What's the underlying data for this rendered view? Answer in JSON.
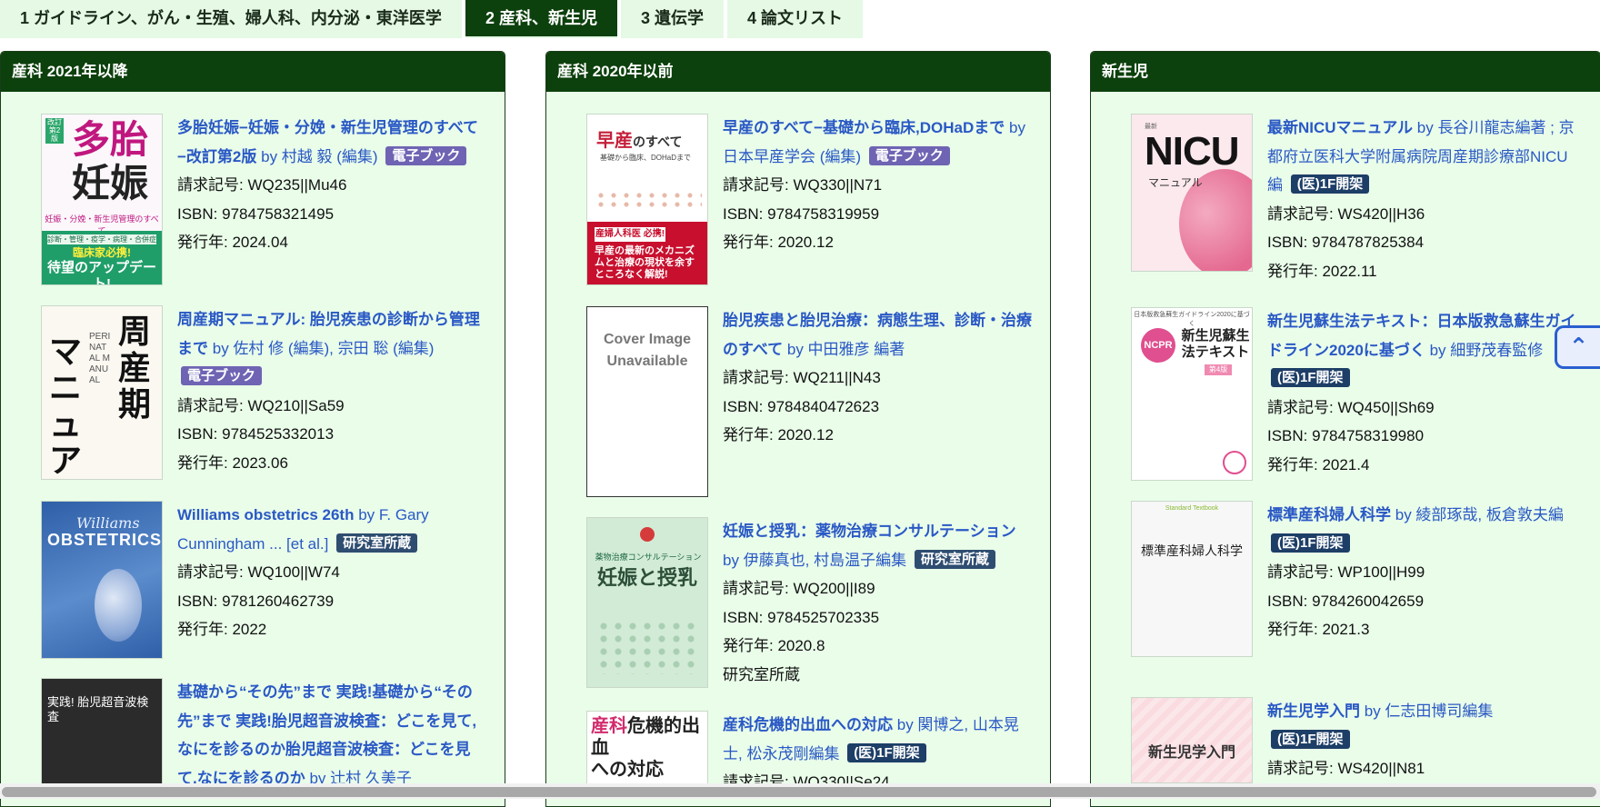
{
  "tabs": [
    {
      "label": "1 ガイドライン、がん・生殖、婦人科、内分泌・東洋医学",
      "active": false
    },
    {
      "label": "2 産科、新生児",
      "active": true
    },
    {
      "label": "3 遺伝学",
      "active": false
    },
    {
      "label": "4 論文リスト",
      "active": false
    }
  ],
  "columns": [
    {
      "heading": "産科 2021年以降",
      "books": [
        {
          "title": "多胎妊娠−妊娠・分娩・新生児管理のすべて−改訂第2版",
          "authors": "by 村越 毅 (編集)",
          "badge": "電子ブック",
          "call": "請求記号: WQ235||Mu46",
          "isbn": "ISBN: 9784758321495",
          "year": "発行年: 2024.04",
          "cover": {
            "tag": "改訂第2版",
            "line1": "多胎",
            "line2": "妊娠",
            "sub": "妊娠・分娩・新生児管理のすべて",
            "b1": "診断・管理・疫学・病理・合併症",
            "b2": "臨床家必携!",
            "b3": "待望のアップデート!"
          }
        },
        {
          "title": "周産期マニュアル: 胎児疾患の診断から管理まで",
          "authors": "by 佐村 修 (編集), 宗田 聡 (編集)",
          "badge": "電子ブック",
          "call": "請求記号: WQ210||Sa59",
          "isbn": "ISBN: 9784525332013",
          "year": "発行年: 2023.06",
          "cover": {
            "v1": "周産期",
            "v2": "マニュアル",
            "en": "PERINATAL MANUAL"
          }
        },
        {
          "title": "Williams obstetrics 26th",
          "authors": "by F. Gary Cunningham ... [et al.]",
          "badge": "研究室所蔵",
          "call": "請求記号: WQ100||W74",
          "isbn": "ISBN: 9781260462739",
          "year": "発行年: 2022",
          "cover": {
            "w": "Williams",
            "o": "OBSTETRICS"
          }
        },
        {
          "title": "基礎から“その先”まで 実践!基礎から“その先”まで 実践!胎児超音波検査：どこを見て,なにを診るのか胎児超音波検査：どこを見て,なにを診るのか",
          "authors": "by 辻村 久美子",
          "badge": "",
          "call": "",
          "isbn": "",
          "year": "",
          "cover": {
            "t": "実践! 胎児超音波検査"
          }
        }
      ]
    },
    {
      "heading": "産科 2020年以前",
      "books": [
        {
          "title": "早産のすべて−基礎から臨床,DOHaDまで",
          "authors": "by 日本早産学会 (編集)",
          "badge": "電子ブック",
          "call": "請求記号: WQ330||N71",
          "isbn": "ISBN: 9784758319959",
          "year": "発行年: 2020.12",
          "cover": {
            "t": "早産",
            "t2": "のすべて",
            "s": "基礎から臨床、DOHaDまで",
            "p": "産婦人科医 必携!",
            "q": "早産の最新のメカニズムと治療の現状を余すところなく解説!"
          }
        },
        {
          "title": "胎児疾患と胎児治療：病態生理、診断・治療のすべて",
          "authors": "by 中田雅彦 編著",
          "badge": "",
          "call": "請求記号: WQ211||N43",
          "isbn": "ISBN: 9784840472623",
          "year": "発行年: 2020.12",
          "cover": {
            "u1": "Cover Image",
            "u2": "Unavailable"
          }
        },
        {
          "title": "妊娠と授乳：薬物治療コンサルテーション",
          "authors": "by 伊藤真也, 村島温子編集",
          "badge": "研究室所蔵",
          "call": "請求記号: WQ200||I89",
          "isbn": "ISBN: 9784525702335",
          "year": "発行年: 2020.8",
          "extra": "研究室所蔵",
          "cover": {
            "t1": "薬物治療コンサルテーション",
            "t2": "妊娠と授乳"
          }
        },
        {
          "title": "産科危機的出血への対応",
          "authors": "by 関博之, 山本晃士, 松永茂剛編集",
          "badge": "(医)1F開架",
          "call": "請求記号: WQ330||Se24",
          "isbn": "",
          "year": "",
          "cover": {
            "t1": "産科",
            "t2": "危機的出血",
            "t3": "への対応"
          }
        }
      ]
    },
    {
      "heading": "新生児",
      "books": [
        {
          "title": "最新NICUマニュアル",
          "authors": "by 長谷川龍志編著 ; 京都府立医科大学附属病院周産期診療部NICU編",
          "badge": "(医)1F開架",
          "call": "請求記号: WS420||H36",
          "isbn": "ISBN: 9784787825384",
          "year": "発行年: 2022.11",
          "cover": {
            "tiny": "最新",
            "logo": "NICU",
            "sub": "マニュアル"
          }
        },
        {
          "title": "新生児蘇生法テキスト：日本版救急蘇生ガイドライン2020に基づく",
          "authors": "by 細野茂春監修",
          "badge": "(医)1F開架",
          "call": "請求記号: WQ450||Sh69",
          "isbn": "ISBN: 9784758319980",
          "year": "発行年: 2021.4",
          "cover": {
            "hd": "日本版救急蘇生ガイドライン2020に基づく",
            "logo": "NCPR",
            "t": "新生児蘇生法テキスト",
            "ed": "第4版"
          }
        },
        {
          "title": "標準産科婦人科学",
          "authors": "by 綾部琢哉, 板倉敦夫編",
          "badge": "(医)1F開架",
          "call": "請求記号: WP100||H99",
          "isbn": "ISBN: 9784260042659",
          "year": "発行年: 2021.3",
          "cover": {
            "s": "Standard Textbook",
            "t": "標準産科婦人科学"
          }
        },
        {
          "title": "新生児学入門",
          "authors": "by 仁志田博司編集",
          "badge": "(医)1F開架",
          "call": "請求記号: WS420||N81",
          "isbn": "",
          "year": "",
          "cover": {
            "t": "新生児学入門"
          }
        }
      ]
    }
  ],
  "back_to_top_icon": "chevron-double-up-icon"
}
